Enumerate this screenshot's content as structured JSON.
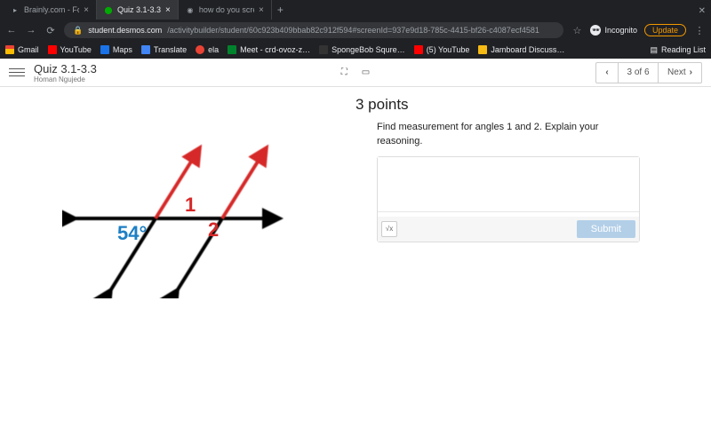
{
  "browser": {
    "tabs": [
      {
        "label": "Brainly.com - For students. By"
      },
      {
        "label": "Quiz 3.1-3.3"
      },
      {
        "label": "how do you screenshot on ma"
      }
    ],
    "url_host": "student.desmos.com",
    "url_path": "/activitybuilder/student/60c923b409bbab82c912f594#screenId=937e9d18-785c-4415-bf26-c4087ecf4581",
    "incognito_label": "Incognito",
    "update_label": "Update",
    "reading_list": "Reading List",
    "bookmarks": {
      "gmail": "Gmail",
      "youtube": "YouTube",
      "maps": "Maps",
      "translate": "Translate",
      "ela": "ela",
      "meet": "Meet - crd-ovoz-z…",
      "sponge": "SpongeBob Squre…",
      "yt2": "(5) YouTube",
      "jam": "Jamboard Discuss…"
    }
  },
  "app": {
    "title": "Quiz 3.1-3.3",
    "user": "Homan Ngujede",
    "page_indicator": "3 of 6",
    "next_label": "Next"
  },
  "question": {
    "points": "3 points",
    "prompt": "Find measurement for angles 1 and 2. Explain your reasoning.",
    "submit_label": "Submit",
    "math_toggle": "√x",
    "figure": {
      "angle1_label": "1",
      "angle2_label": "2",
      "given_angle": "54°"
    }
  }
}
